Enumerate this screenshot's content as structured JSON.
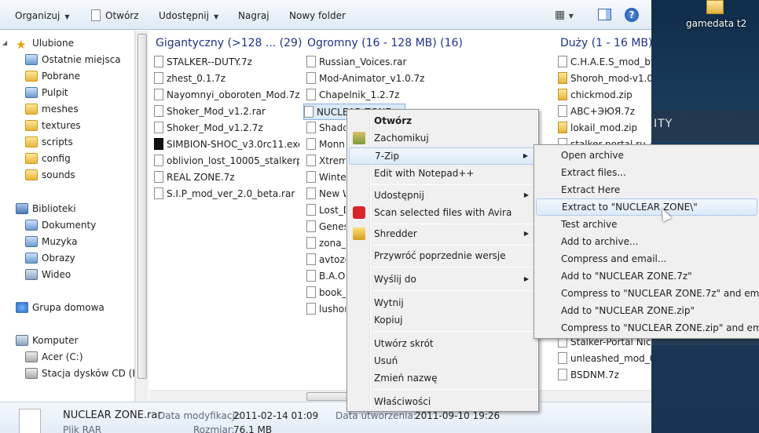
{
  "toolbar": {
    "organize": "Organizuj",
    "open": "Otwórz",
    "share": "Udostępnij",
    "burn": "Nagraj",
    "new_folder": "Nowy folder"
  },
  "nav": {
    "favorites": "Ulubione",
    "recent": "Ostatnie miejsca",
    "downloads": "Pobrane",
    "desktop": "Pulpit",
    "folders": [
      "meshes",
      "textures",
      "scripts",
      "config",
      "sounds"
    ],
    "libraries": "Biblioteki",
    "lib_items": [
      "Dokumenty",
      "Muzyka",
      "Obrazy",
      "Wideo"
    ],
    "homegroup": "Grupa domowa",
    "computer": "Komputer",
    "drive_c": "Acer (C:)",
    "drive_e": "Stacja dysków CD (E:) E"
  },
  "groups": [
    {
      "header": "Gigantyczny (>128 ... (29)",
      "files": [
        "STALKER--DUTY.7z",
        "zhest_0.1.7z",
        "Nayomnyi_oboroten_Mod.7z",
        "Shoker_Mod_v1.2.rar",
        "Shoker_Mod_v1.2.7z",
        "SIMBION-SHOC_v3.0rc11.exe",
        "oblivion_lost_10005_stalkerpl.7z",
        "REAL ZONE.7z",
        "S.I.P_mod_ver_2.0_beta.rar"
      ]
    },
    {
      "header": "Ogromny (16 - 128 MB) (16)",
      "files": [
        "Russian_Voices.rar",
        "Mod-Animator_v1.0.7z",
        "Chapelnik_1.2.7z",
        "NUCLEAR ZONE",
        "Shado",
        "Monn",
        "Xtrem",
        "Winte",
        "New W",
        "Lost_D",
        "Genesi",
        "zona_p",
        "avtozo",
        "B.A.O.",
        "book_",
        "lushor"
      ]
    },
    {
      "header": "Duży (1 - 16 MB)",
      "files_top": [
        "C.H.A.E.S_mod_by_",
        "Shoroh_mod-v1.0.z",
        "chickmod.zip",
        "ABC+ЭЮЯ.7z",
        "lokail_mod.zip",
        "stalker-portal.ru_s"
      ],
      "files_bottom": [
        "Stalker-Portal Nick",
        "unleashed_mod_0.3",
        "BSDNM.7z"
      ]
    }
  ],
  "context_menu": {
    "items": [
      "Otwórz",
      "Zachomikuj",
      "7-Zip",
      "Edit with Notepad++",
      "Udostępnij",
      "Scan selected files with Avira",
      "Shredder",
      "Przywróć poprzednie wersje",
      "Wyślij do",
      "Wytnij",
      "Kopiuj",
      "Utwórz skrót",
      "Usuń",
      "Zmień nazwę",
      "Właściwości"
    ]
  },
  "submenu": {
    "items": [
      "Open archive",
      "Extract files...",
      "Extract Here",
      "Extract to \"NUCLEAR ZONE\\\"",
      "Test archive",
      "Add to archive...",
      "Compress and email...",
      "Add to \"NUCLEAR ZONE.7z\"",
      "Compress to \"NUCLEAR ZONE.7z\" and email",
      "Add to \"NUCLEAR ZONE.zip\"",
      "Compress to \"NUCLEAR ZONE.zip\" and email"
    ]
  },
  "details": {
    "name": "NUCLEAR ZONE.rar",
    "type": "Plik RAR",
    "modified_label": "Data modyfikacji:",
    "modified": "2011-02-14 01:09",
    "created_label": "Data utworzenia:",
    "created": "2011-09-10 19:26",
    "size_label": "Rozmiar:",
    "size": "76,1 MB"
  },
  "desktop": {
    "folder_label": "gamedata t2",
    "text": "ITY"
  }
}
